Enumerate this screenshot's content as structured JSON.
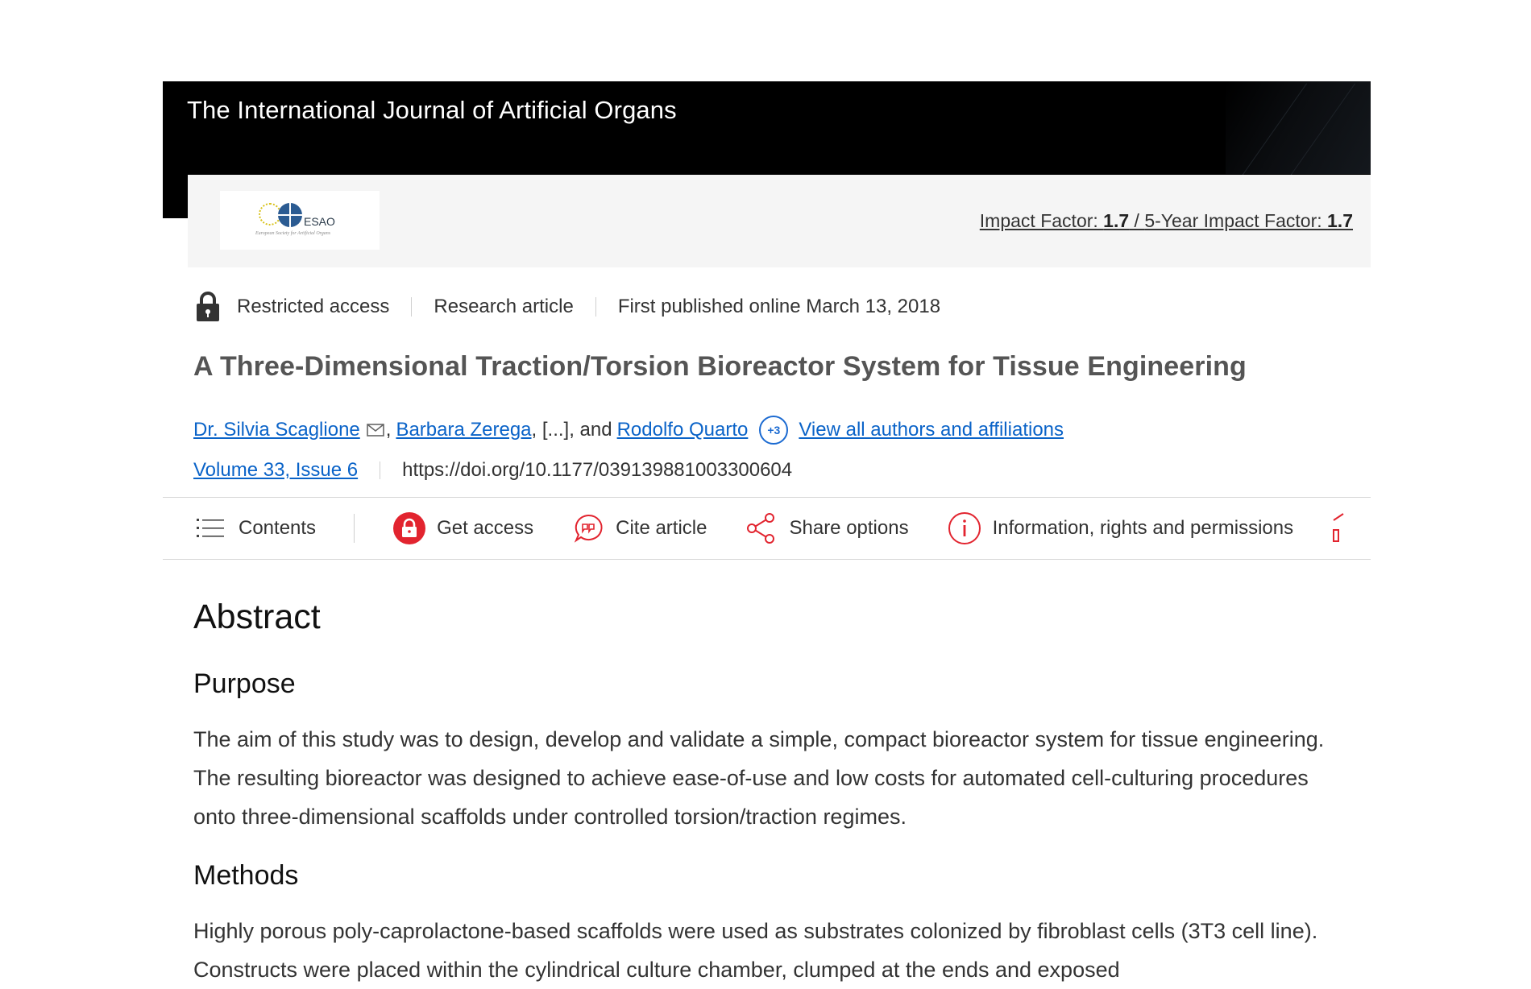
{
  "journal": {
    "title": "The International Journal of Artificial Organs",
    "logo_text": "ESAO",
    "logo_tagline": "European Society for Artificial Organs",
    "impact_label": "Impact Factor: ",
    "impact_value": "1.7",
    "impact_sep": " / ",
    "five_year_label": "5-Year Impact Factor: ",
    "five_year_value": "1.7"
  },
  "meta": {
    "access": "Restricted access",
    "type": "Research article",
    "published": "First published online March 13, 2018"
  },
  "article": {
    "title": "A Three-Dimensional Traction/Torsion Bioreactor System for Tissue Engineering",
    "author1": "Dr. Silvia Scaglione",
    "author_sep": ",",
    "author2": "Barbara Zerega",
    "ellipsis": ", [...], and",
    "author3": "Rodolfo Quarto",
    "more_count": "+3",
    "view_all": "View all authors and affiliations",
    "volume": "Volume 33, Issue 6",
    "doi": "https://doi.org/10.1177/039139881003300604"
  },
  "toolbar": {
    "contents": "Contents",
    "get_access": "Get access",
    "cite": "Cite article",
    "share": "Share options",
    "info": "Information, rights and permissions"
  },
  "abstract": {
    "heading": "Abstract",
    "purpose_heading": "Purpose",
    "purpose_text": "The aim of this study was to design, develop and validate a simple, compact bioreactor system for tissue engineering. The resulting bioreactor was designed to achieve ease-of-use and low costs for automated cell-culturing procedures onto three-dimensional scaffolds under controlled torsion/traction regimes.",
    "methods_heading": "Methods",
    "methods_text": "Highly porous poly-caprolactone-based scaffolds were used as substrates colonized by fibroblast cells (3T3 cell line). Constructs were placed within the cylindrical culture chamber, clumped at the ends and exposed"
  },
  "colors": {
    "banner": "#000000",
    "link": "#0a63c8",
    "accent_red": "#e2242f"
  }
}
